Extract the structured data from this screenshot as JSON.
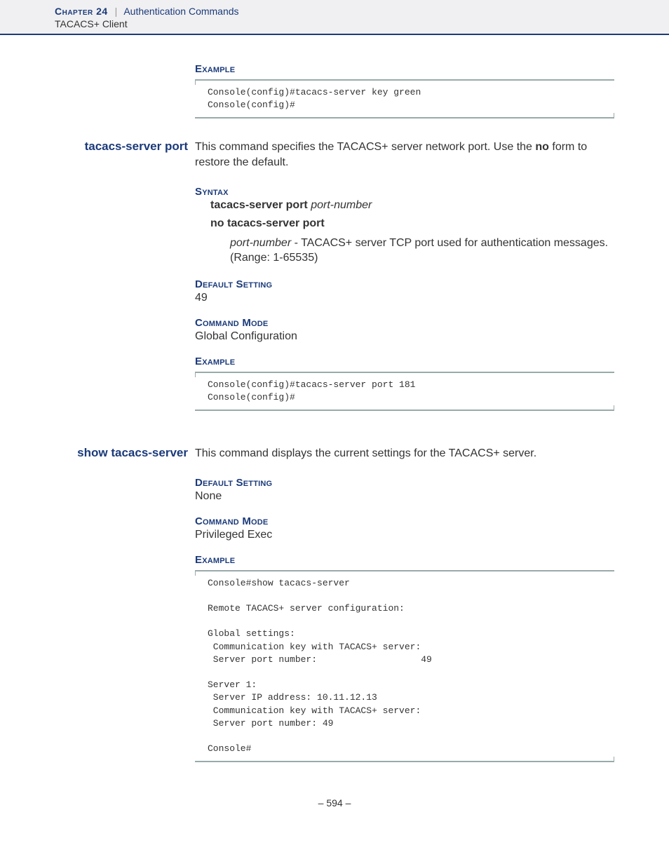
{
  "header": {
    "chapter_label": "Chapter 24",
    "separator": "|",
    "chapter_title": "Authentication Commands",
    "subsection": "TACACS+ Client"
  },
  "block1": {
    "heading_example": "Example",
    "code": "Console(config)#tacacs-server key green\nConsole(config)#"
  },
  "cmd1": {
    "name": "tacacs-server port",
    "desc_pre": "This command specifies the TACACS+ server network port. Use the ",
    "desc_bold": "no",
    "desc_post": " form to restore the default.",
    "h_syntax": "Syntax",
    "syntax_cmd_bold": "tacacs-server port",
    "syntax_cmd_ital": "port-number",
    "syntax_no": "no tacacs-server port",
    "param_name": "port-number",
    "param_desc": " - TACACS+ server TCP port used for authentication messages. (Range: 1-65535)",
    "h_default": "Default Setting",
    "default_value": "49",
    "h_mode": "Command Mode",
    "mode_value": "Global Configuration",
    "h_example": "Example",
    "code": "Console(config)#tacacs-server port 181\nConsole(config)#"
  },
  "cmd2": {
    "name": "show tacacs-server",
    "desc": "This command displays the current settings for the TACACS+ server.",
    "h_default": "Default Setting",
    "default_value": "None",
    "h_mode": "Command Mode",
    "mode_value": "Privileged Exec",
    "h_example": "Example",
    "code": "Console#show tacacs-server\n\nRemote TACACS+ server configuration:\n\nGlobal settings:\n Communication key with TACACS+ server:\n Server port number:                   49\n\nServer 1:\n Server IP address: 10.11.12.13\n Communication key with TACACS+ server:\n Server port number: 49\n\nConsole#"
  },
  "page_number": "– 594 –"
}
